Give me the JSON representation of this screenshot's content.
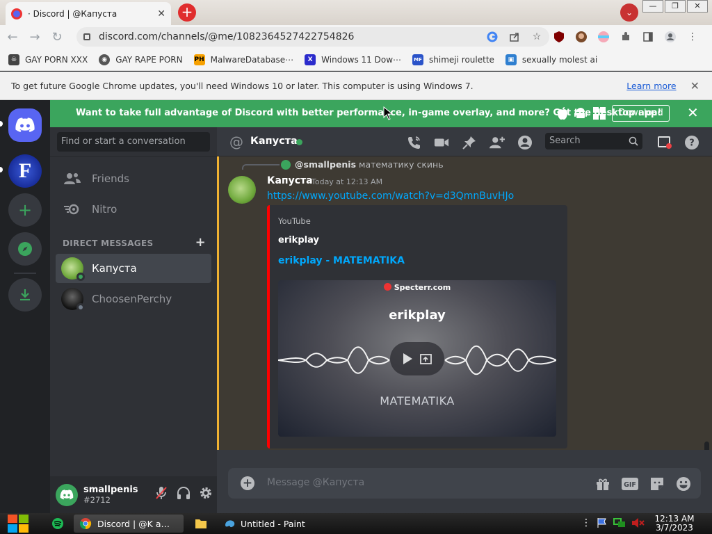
{
  "browser": {
    "tab_title": "· Discord | @Капуста",
    "tab_close": "✕",
    "new_tab": "+",
    "tab_search": "⌄",
    "window_controls": [
      "—",
      "❐",
      "✕"
    ],
    "url": "discord.com/channels/@me/1082364527422754826",
    "bookmarks": [
      {
        "label": "GAY PORN XXX",
        "icon": "skull-icon",
        "color": "#444444",
        "glyph": "☠"
      },
      {
        "label": "GAY RAPE PORN",
        "icon": "globe-icon",
        "color": "#555555",
        "glyph": "◉"
      },
      {
        "label": "MalwareDatabase⋯",
        "icon": "ph-icon",
        "color": "#f7a100",
        "glyph": "PH"
      },
      {
        "label": "Windows 11 Dow⋯",
        "icon": "x-icon",
        "color": "#2b2bcc",
        "glyph": "X"
      },
      {
        "label": "shimeji roulette",
        "icon": "mf-icon",
        "color": "#2a53c9",
        "glyph": "MF"
      },
      {
        "label": "sexually molest ai",
        "icon": "archive-icon",
        "color": "#2f7fd0",
        "glyph": "▣"
      }
    ],
    "infobar_message": "To get future Google Chrome updates, you'll need Windows 10 or later. This computer is using Windows 7.",
    "infobar_link": "Learn more",
    "infobar_close": "✕"
  },
  "banner": {
    "text": "Want to take full advantage of Discord with better performance, in-game overlay, and more? Get the desktop app!",
    "download": "Download",
    "close": "✕"
  },
  "sidebar": {
    "search_placeholder": "Find or start a conversation",
    "friends": "Friends",
    "nitro": "Nitro",
    "dm_header": "DIRECT MESSAGES",
    "dm_add": "+",
    "dms": [
      {
        "name": "Капуста",
        "status_color": "#3ba55d"
      },
      {
        "name": "ChoosenPerchy",
        "status_color": "#747f8d"
      }
    ]
  },
  "user": {
    "name": "smallpenis",
    "tag": "#2712"
  },
  "chat": {
    "at": "@",
    "channel": "Капуста",
    "search_placeholder": "Search",
    "reply_author": "@smallpenis",
    "reply_text": "математику скинь",
    "author": "Капуста",
    "timestamp": "Today at 12:13 AM",
    "link": "https://www.youtube.com/watch?v=d3QmnBuvHJo",
    "embed": {
      "provider": "YouTube",
      "author": "erikplay",
      "title": "erikplay - MATEMATIKA",
      "thumb_watermark": "Specterr.com",
      "thumb_channel": "erikplay",
      "thumb_title": "MATEMATIKA"
    },
    "composer_placeholder": "Message @Капуста",
    "composer_add": "+",
    "gif_label": "GIF"
  },
  "taskbar": {
    "tasks": [
      "Discord | @K a…",
      "Untitled - Paint"
    ],
    "time": "12:13 AM",
    "date": "3/7/2023"
  },
  "colors": {
    "blurple": "#5865f2",
    "green": "#3ba55d",
    "link": "#00a8fc",
    "youtube_red": "#ff0000",
    "mention_bar": "#f0b232"
  }
}
